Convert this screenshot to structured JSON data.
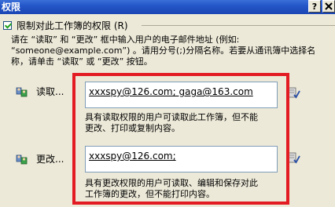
{
  "window": {
    "title": "权限",
    "help_label": "?"
  },
  "restrict": {
    "label": "限制对此工作簿的权限 (R)"
  },
  "instructions": {
    "text": "请在 “读取” 和 “更改” 框中输入用户的电子邮件地址 (例如:\n “someone@example.com”) 。请用分号(;)分隔名称。若要从通讯簿中选择名\n称，请单击 “读取” 或 “更改” 按钮。"
  },
  "read": {
    "button_label": "读取...",
    "value": "xxxspy@126.com; gaga@163.com",
    "description": "具有读取权限的用户可读取此工作簿，但不能\n更改、打印或复制内容。"
  },
  "change": {
    "button_label": "更改...",
    "value": "xxxspy@126.com;",
    "description": "具有更改权限的用户可读取、编辑和保存对此\n工作簿的更改，但不能打印内容。"
  },
  "colors": {
    "titlebar": "#2456c8",
    "highlight": "#e31b23",
    "dialog_bg": "#ece9d8"
  },
  "icons": {
    "read_user": "users-icon",
    "change_user": "users-icon",
    "read_book": "address-book-icon",
    "change_book": "address-book-icon"
  }
}
